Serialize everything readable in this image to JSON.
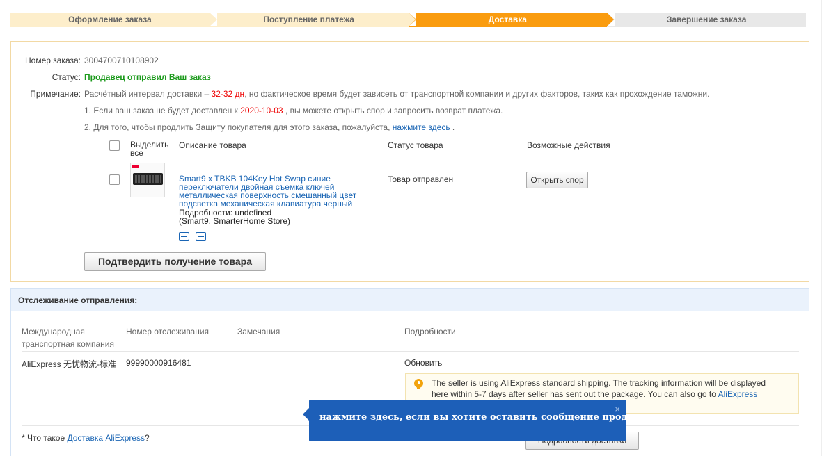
{
  "steps": [
    {
      "label": "Оформление заказа",
      "state": "done"
    },
    {
      "label": "Поступление платежа",
      "state": "done"
    },
    {
      "label": "Доставка",
      "state": "active"
    },
    {
      "label": "Завершение заказа",
      "state": "todo"
    }
  ],
  "order": {
    "number_label": "Номер заказа:",
    "number_value": "3004700710108902",
    "status_label": "Статус:",
    "status_value": "Продавец отправил Ваш заказ",
    "note_label": "Примечание:",
    "note_part1": "Расчётный интервал доставки – ",
    "note_days": "32-32 дн",
    "note_part2": ", но фактическое время будет зависеть от транспортной компании и других факторов, таких как прохождение таможни.",
    "line1_part1": "1. Если ваш заказ не будет доставлен к ",
    "line1_date": "2020-10-03",
    "line1_part2": " , вы можете открыть спор и запросить возврат платежа.",
    "line2_part1": "2. Для того, чтобы продлить Защиту покупателя для этого заказа, пожалуйста, ",
    "line2_link": "нажмите здесь",
    "line2_part2": " ."
  },
  "table": {
    "col_select_all": "Выделить все",
    "col_description": "Описание товара",
    "col_status": "Статус товара",
    "col_actions": "Возможные действия"
  },
  "product": {
    "title": "Smart9 x TBKB 104Key Hot Swap синие переключатели двойная съемка ключей металлическая поверхность смешанный цвет подсветка механическая клавиатура черный",
    "details": "Подробности: undefined",
    "store": "(Smart9, SmarterHome Store)",
    "status": "Товар отправлен",
    "dispute_button": "Открыть спор"
  },
  "confirm_button": "Подтвердить получение товара",
  "tracking": {
    "header": "Отслеживание отправления:",
    "col_carrier": "Международная транспортная компания",
    "col_number": "Номер отслеживания",
    "col_remarks": "Замечания",
    "col_details": "Подробности",
    "carrier": "AliExpress 无忧物流-标准",
    "number": "99990000916481",
    "refresh_link": "Обновить",
    "notice_text": "The seller is using AliExpress standard shipping. The tracking information will be displayed here within 5-7 days after seller has sent out the package. You can also go to ",
    "notice_link": "AliExpress",
    "footer_question": "* Что такое ",
    "footer_link": "Доставка AliExpress",
    "footer_q_end": "?",
    "details_button": "Подробности доставки"
  },
  "tooltip": {
    "text": "нажмите здесь, если вы хотите оставить сообщение продавцу.",
    "close": "×"
  },
  "colors": {
    "step_active": "#fa9c0f",
    "step_done": "#fdeecb",
    "step_todo": "#e8e8e8",
    "status_green": "#1c9a1c",
    "link_blue": "#1a65b4",
    "highlight_red": "#e00",
    "tooltip_bg": "#1d5fb8"
  }
}
